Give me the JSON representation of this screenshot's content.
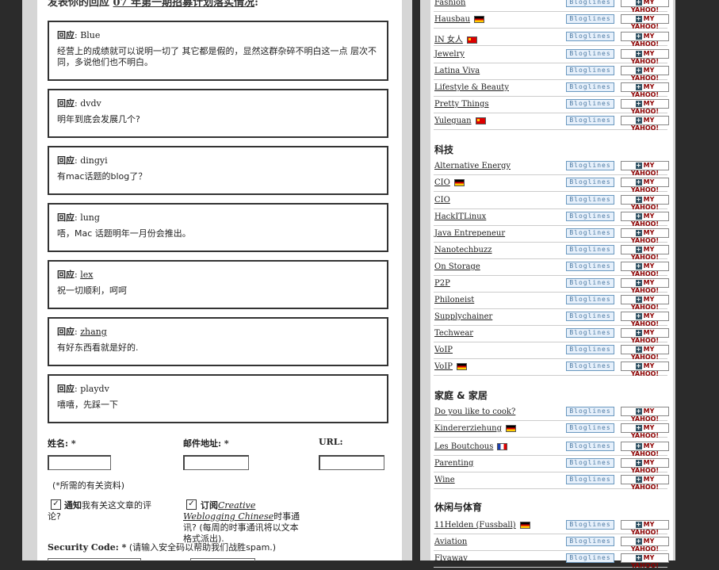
{
  "left": {
    "heading_prefix": "发表你的回应",
    "heading_link": "07 年第一期招募计划落实情况",
    "heading_suffix": ":",
    "comments": [
      {
        "label": "回应",
        "author": "Blue",
        "author_linked": false,
        "body": "经营上的成绩就可以说明一切了 其它都是假的，显然这群杂碎不明白这一点 层次不同，多说他们也不明白。"
      },
      {
        "label": "回应",
        "author": "dvdv",
        "author_linked": false,
        "body": "明年到底会发展几个?"
      },
      {
        "label": "回应",
        "author": "dingyi",
        "author_linked": false,
        "body": "有mac话题的blog了？"
      },
      {
        "label": "回应",
        "author": "lung",
        "author_linked": false,
        "body": "唔，Mac 话题明年一月份会推出。"
      },
      {
        "label": "回应",
        "author": "lex",
        "author_linked": true,
        "body": "祝一切顺利，呵呵"
      },
      {
        "label": "回应",
        "author": "zhang",
        "author_linked": true,
        "body": "有好东西看就是好的."
      },
      {
        "label": "回应",
        "author": "playdv",
        "author_linked": false,
        "body": "嘻嘻，先踩一下"
      }
    ],
    "form": {
      "name_label": "姓名: *",
      "email_label": "邮件地址: *",
      "url_label": "URL:",
      "required_note": "(*所需的有关资料)",
      "notify_bold": "通知",
      "notify_text": "我有关这文章的评论?",
      "subscribe_bold": "订阅",
      "subscribe_italic": "Creative Weblogging Chinese",
      "subscribe_text": "时事通讯? (每周的时事通讯将以文本格式派出).",
      "security_bold": "Security Code: *",
      "security_text": " (请输入安全码以帮助我们战胜spam.)"
    }
  },
  "right": {
    "bloglines_label": "Bloglines",
    "yahoo_label": "MY YAHOO!",
    "top_rows": [
      {
        "name": "Fashion",
        "flag": ""
      },
      {
        "name": "Hausbau",
        "flag": "de"
      },
      {
        "name": "IN 女人",
        "flag": "cn"
      },
      {
        "name": "Jewelry",
        "flag": ""
      },
      {
        "name": "Latina Viva",
        "flag": ""
      },
      {
        "name": "Lifestyle & Beauty",
        "flag": ""
      },
      {
        "name": "Pretty Things",
        "flag": ""
      },
      {
        "name": "Yuleguan",
        "flag": "cn"
      }
    ],
    "sections": [
      {
        "title": "科技",
        "rows": [
          {
            "name": "Alternative Energy",
            "flag": ""
          },
          {
            "name": "CIO",
            "flag": "de"
          },
          {
            "name": "CIO",
            "flag": ""
          },
          {
            "name": "HackITLinux",
            "flag": ""
          },
          {
            "name": "Java Entrepeneur",
            "flag": ""
          },
          {
            "name": "Nanotechbuzz",
            "flag": ""
          },
          {
            "name": "On Storage",
            "flag": ""
          },
          {
            "name": "P2P",
            "flag": ""
          },
          {
            "name": "Philoneist",
            "flag": ""
          },
          {
            "name": "Supplychainer",
            "flag": ""
          },
          {
            "name": "Techwear",
            "flag": ""
          },
          {
            "name": "VoIP",
            "flag": ""
          },
          {
            "name": "VoIP",
            "flag": "de"
          }
        ]
      },
      {
        "title": "家庭 & 家居",
        "rows": [
          {
            "name": "Do you like to cook?",
            "flag": ""
          },
          {
            "name": "Kindererziehung",
            "flag": "de"
          },
          {
            "name": "Les Boutchous",
            "flag": "fr"
          },
          {
            "name": "Parenting",
            "flag": ""
          },
          {
            "name": "Wine",
            "flag": ""
          }
        ]
      },
      {
        "title": "休闲与体育",
        "rows": [
          {
            "name": "11Helden (Fussball)",
            "flag": "de"
          },
          {
            "name": "Aviation",
            "flag": ""
          },
          {
            "name": "Flyaway",
            "flag": ""
          }
        ]
      }
    ]
  }
}
